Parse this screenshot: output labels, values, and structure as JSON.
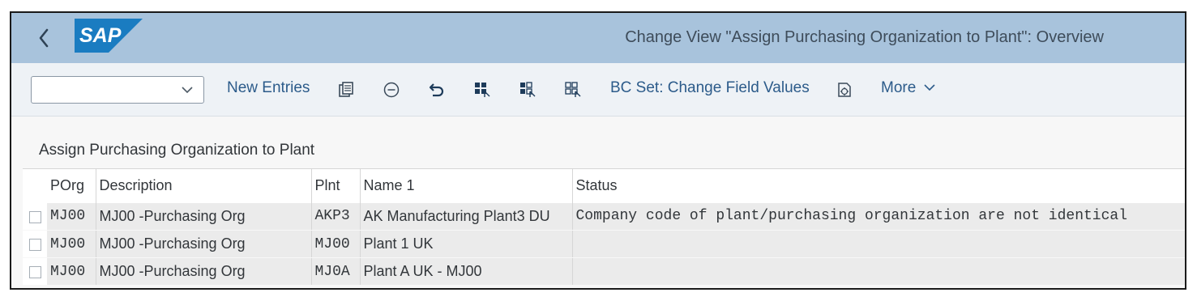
{
  "shell": {
    "title": "Change View \"Assign Purchasing Organization to Plant\": Overview",
    "logo_text": "SAP",
    "colors": {
      "header_bg": "#a8c3dc",
      "logo_blue": "#1a7cc1"
    }
  },
  "toolbar": {
    "variant_value": "",
    "new_entries_label": "New Entries",
    "bc_set_label": "BC Set: Change Field Values",
    "more_label": "More",
    "icons": [
      "copy-as-icon",
      "delete-icon",
      "undo-icon",
      "select-all-icon",
      "select-block-icon",
      "deselect-all-icon",
      "bc-set-icon"
    ]
  },
  "section": {
    "title": "Assign Purchasing Organization to Plant"
  },
  "table": {
    "columns": [
      "POrg",
      "Description",
      "Plnt",
      "Name 1",
      "Status"
    ],
    "rows": [
      {
        "porg": "MJ00",
        "description": "MJ00 -Purchasing Org",
        "plnt": "AKP3",
        "name1": "AK Manufacturing Plant3 DU",
        "status": "Company code of plant/purchasing organization are not identical"
      },
      {
        "porg": "MJ00",
        "description": "MJ00 -Purchasing Org",
        "plnt": "MJ00",
        "name1": "Plant 1 UK",
        "status": ""
      },
      {
        "porg": "MJ00",
        "description": "MJ00 -Purchasing Org",
        "plnt": "MJ0A",
        "name1": "Plant A UK - MJ00",
        "status": ""
      }
    ]
  }
}
